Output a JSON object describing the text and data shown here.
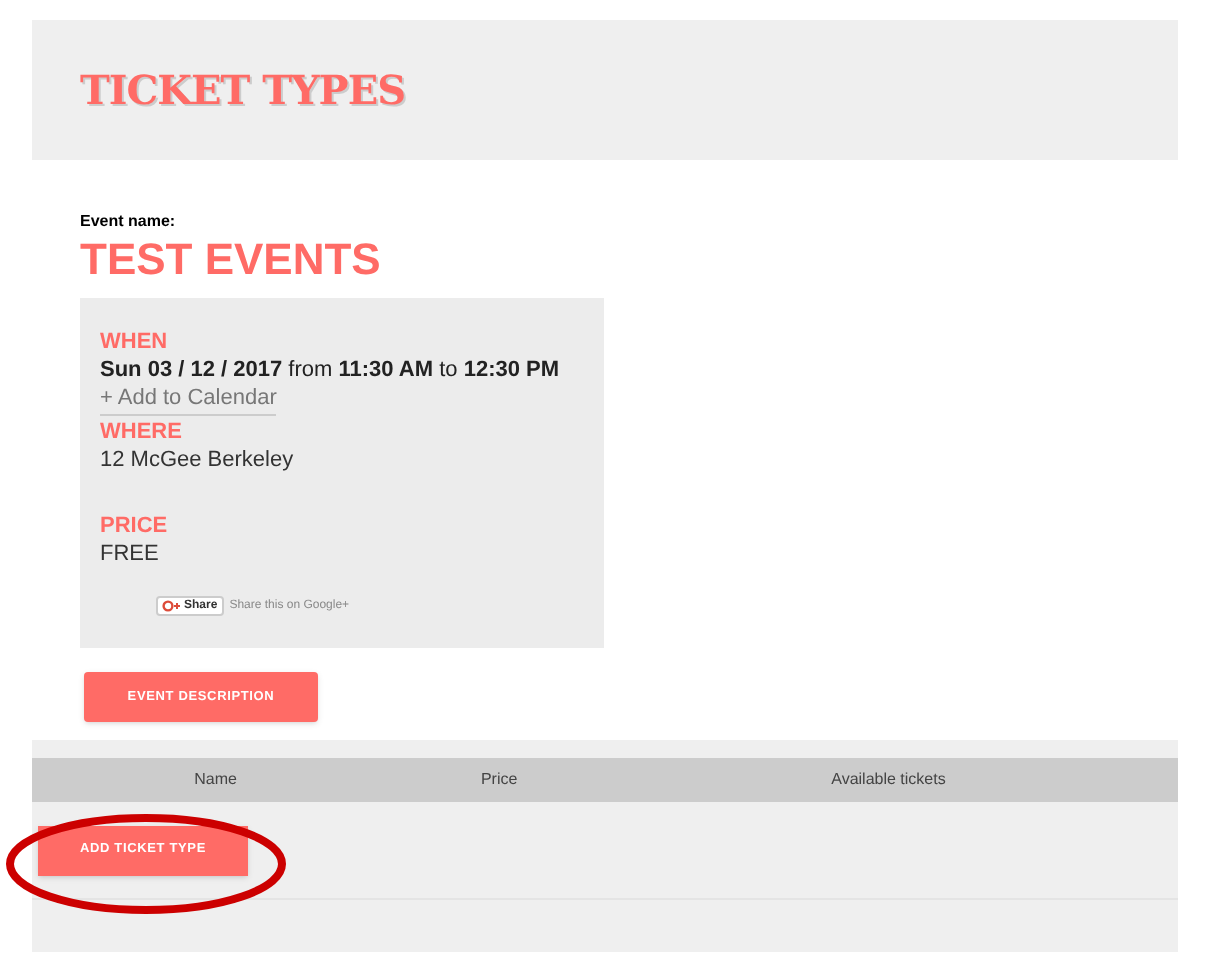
{
  "page_title": "TICKET TYPES",
  "event": {
    "name_label": "Event name:",
    "name": "TEST EVENTS"
  },
  "details": {
    "when_label": "WHEN",
    "when": "**Sun 03 / 12 / 2017** from **11:30 AM** to **12:30 PM**",
    "add_to_calendar": "+ Add to Calendar",
    "where_label": "WHERE",
    "where": "12 McGee Berkeley",
    "price_label": "PRICE",
    "price": "FREE",
    "share_button": "Share",
    "share_text": "Share this on Google+"
  },
  "description_button": "EVENT DESCRIPTION",
  "table": {
    "columns": [
      "Name",
      "Price",
      "Available tickets"
    ]
  },
  "add_button": "ADD TICKET TYPE"
}
